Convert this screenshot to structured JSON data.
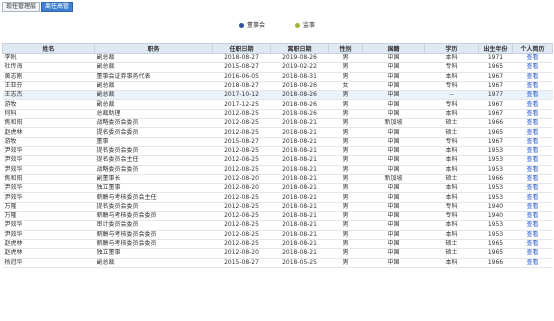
{
  "tabs": [
    {
      "label": "现任管理层"
    },
    {
      "label": "离任高管"
    }
  ],
  "legend": [
    {
      "label": "董事会",
      "color": "#2f4fa3"
    },
    {
      "label": "监事",
      "color": "#9ab733"
    }
  ],
  "columns": [
    "姓名",
    "职务",
    "任职日期",
    "离职日期",
    "性别",
    "国籍",
    "学历",
    "出生年份",
    "个人简历"
  ],
  "rows": [
    [
      "李帆",
      "副总裁",
      "2018-08-27",
      "2019-08-26",
      "男",
      "中国",
      "本科",
      "1971",
      "查看"
    ],
    [
      "杜传海",
      "副总裁",
      "2015-08-27",
      "2019-02-22",
      "男",
      "中国",
      "专科",
      "1965",
      "查看"
    ],
    [
      "黄志刚",
      "董事会证券事务代表",
      "2016-06-05",
      "2018-08-31",
      "男",
      "中国",
      "本科",
      "1967",
      "查看"
    ],
    [
      "王亚芬",
      "副总裁",
      "2018-08-27",
      "2018-08-26",
      "女",
      "中国",
      "专科",
      "1967",
      "查看"
    ],
    [
      "王志杰",
      "副总裁",
      "2017-10-12",
      "2018-08-26",
      "男",
      "中国",
      "--",
      "1977",
      "查看"
    ],
    [
      "游牧",
      "副总裁",
      "2017-12-25",
      "2018-08-26",
      "男",
      "中国",
      "专科",
      "1967",
      "查看"
    ],
    [
      "何科",
      "总裁助理",
      "2012-08-25",
      "2018-08-26",
      "男",
      "中国",
      "本科",
      "1967",
      "查看"
    ],
    [
      "焦和阳",
      "战略委员会委员",
      "2012-08-25",
      "2018-08-21",
      "男",
      "新加坡",
      "硕士",
      "1966",
      "查看"
    ],
    [
      "赵虎林",
      "提名委员会委员",
      "2012-08-25",
      "2018-08-21",
      "男",
      "中国",
      "硕士",
      "1965",
      "查看"
    ],
    [
      "游牧",
      "董事",
      "2015-08-27",
      "2018-08-21",
      "男",
      "中国",
      "专科",
      "1967",
      "查看"
    ],
    [
      "尹效华",
      "提名委员会委员",
      "2012-08-25",
      "2018-08-21",
      "男",
      "中国",
      "本科",
      "1953",
      "查看"
    ],
    [
      "尹效华",
      "提名委员会主任",
      "2012-08-25",
      "2018-08-21",
      "男",
      "中国",
      "本科",
      "1953",
      "查看"
    ],
    [
      "尹效华",
      "战略委员会委员",
      "2012-08-25",
      "2018-08-21",
      "男",
      "中国",
      "本科",
      "1953",
      "查看"
    ],
    [
      "焦和阳",
      "副董事长",
      "2012-08-20",
      "2018-08-21",
      "男",
      "新加坡",
      "硕士",
      "1966",
      "查看"
    ],
    [
      "尹效华",
      "独立董事",
      "2012-08-20",
      "2018-08-21",
      "男",
      "中国",
      "本科",
      "1953",
      "查看"
    ],
    [
      "尹效华",
      "薪酬与考核委员会主任",
      "2012-08-25",
      "2018-08-21",
      "男",
      "中国",
      "本科",
      "1953",
      "查看"
    ],
    [
      "万隆",
      "提名委员会委员",
      "2012-08-25",
      "2018-08-21",
      "男",
      "中国",
      "专科",
      "1940",
      "查看"
    ],
    [
      "万隆",
      "薪酬与考核委员会委员",
      "2012-08-25",
      "2018-08-21",
      "男",
      "中国",
      "专科",
      "1940",
      "查看"
    ],
    [
      "尹效华",
      "审计委员会委员",
      "2012-08-25",
      "2018-08-21",
      "男",
      "中国",
      "本科",
      "1953",
      "查看"
    ],
    [
      "尹效华",
      "薪酬与考核委员会委员",
      "2012-08-25",
      "2018-08-21",
      "男",
      "中国",
      "本科",
      "1953",
      "查看"
    ],
    [
      "赵虎林",
      "薪酬与考核委员会委员",
      "2012-08-25",
      "2018-08-21",
      "男",
      "中国",
      "硕士",
      "1965",
      "查看"
    ],
    [
      "赵虎林",
      "独立董事",
      "2012-08-20",
      "2018-08-21",
      "男",
      "中国",
      "硕士",
      "1965",
      "查看"
    ],
    [
      "杨冠华",
      "副总裁",
      "2015-08-27",
      "2018-05-25",
      "男",
      "中国",
      "本科",
      "1966",
      "查看"
    ]
  ]
}
